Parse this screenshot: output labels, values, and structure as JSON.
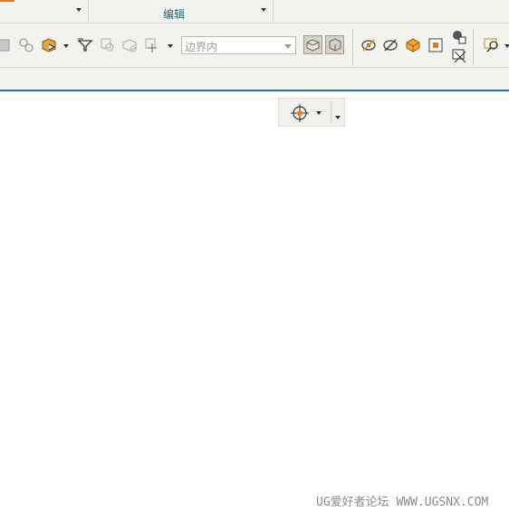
{
  "ribbon": {
    "group_label_edit": "编辑"
  },
  "toolbar": {
    "selection_scope": {
      "value": "边界内",
      "options_visible": [
        "边界内"
      ]
    },
    "icons": [
      "body-faces-icon",
      "feature-points-icon",
      "component-select-icon",
      "filter-select-icon",
      "group-select-icon",
      "body-select-icon",
      "point-snap-icon",
      "shaded-view-icon",
      "wireframe-view-icon",
      "hide-icon",
      "show-hide-icon",
      "orange-cube-icon",
      "orange-square-icon",
      "layer-icon",
      "layer-settings-icon",
      "zoom-icon"
    ]
  },
  "snap_toolbar": {
    "icon": "target-snap-icon"
  },
  "colors": {
    "accent_blue": "#1f7a9c",
    "brand_orange": "#e8781e",
    "group_label": "#0b6d88"
  },
  "watermark": "UG爱好者论坛 WWW.UGSNX.COM"
}
